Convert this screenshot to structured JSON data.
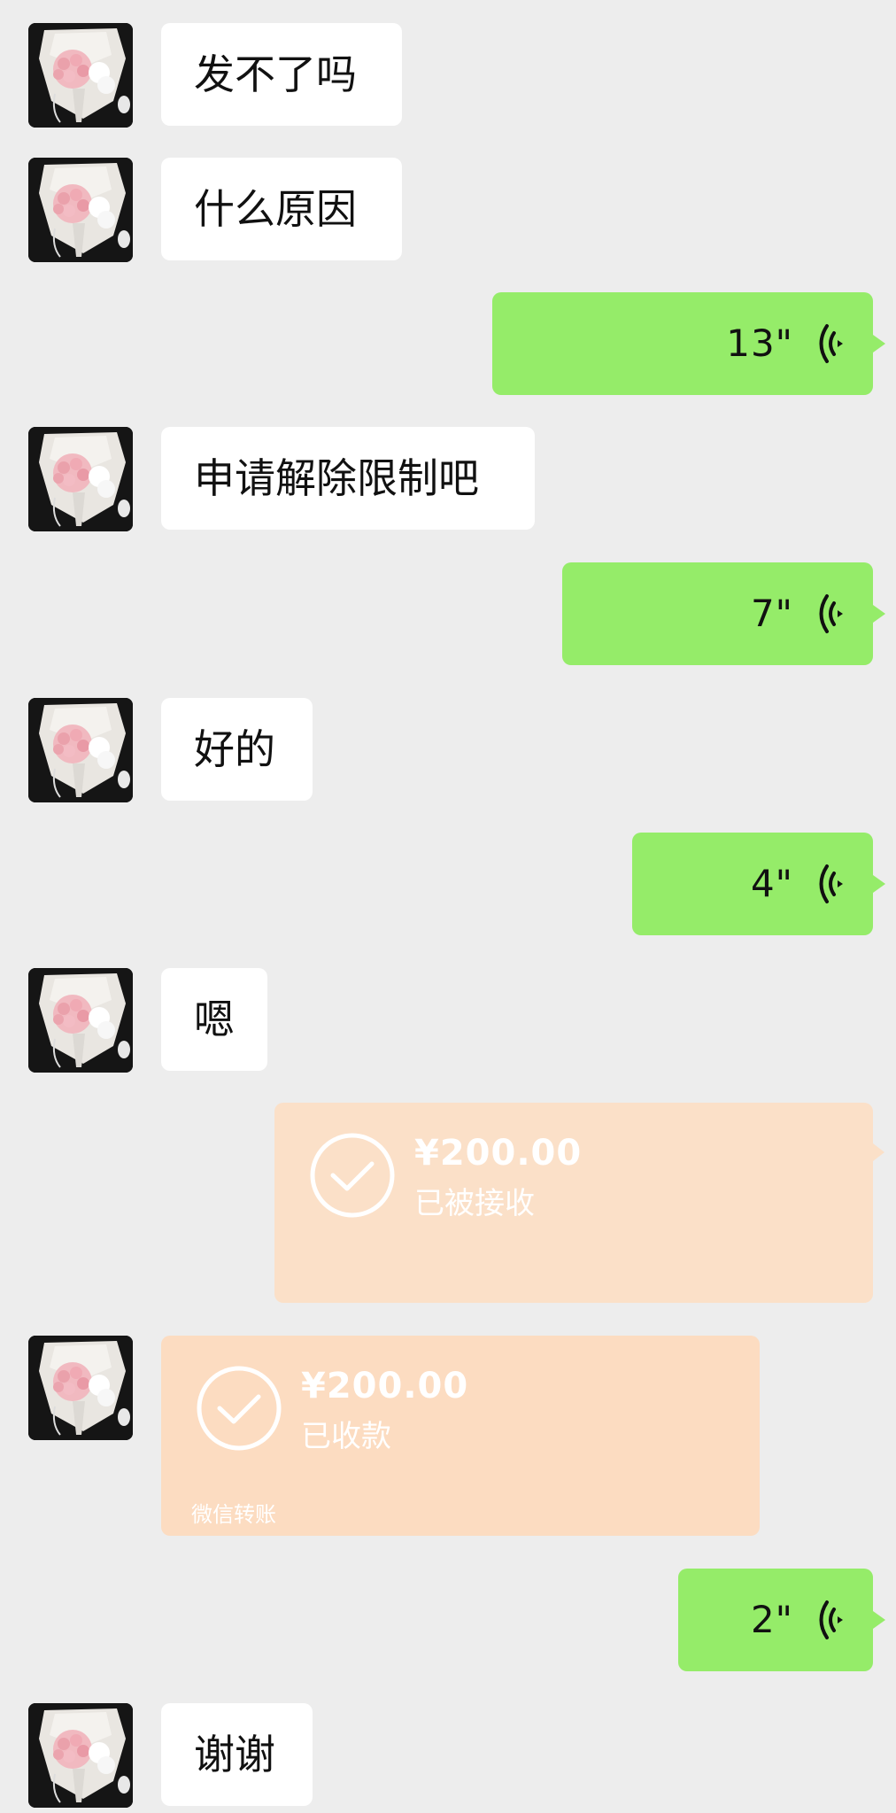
{
  "colors": {
    "background": "#ededed",
    "incoming_bubble": "#ffffff",
    "outgoing_bubble": "#95ec69",
    "transfer_card": "#fbe0c8"
  },
  "contact": {
    "avatar_icon": "flower-bouquet-avatar"
  },
  "messages": [
    {
      "type": "text",
      "side": "in",
      "text": "发不了吗"
    },
    {
      "type": "text",
      "side": "in",
      "text": "什么原因"
    },
    {
      "type": "voice",
      "side": "out",
      "duration": "13\""
    },
    {
      "type": "text",
      "side": "in",
      "text": "申请解除限制吧"
    },
    {
      "type": "voice",
      "side": "out",
      "duration": "7\""
    },
    {
      "type": "text",
      "side": "in",
      "text": "好的"
    },
    {
      "type": "voice",
      "side": "out",
      "duration": "4\""
    },
    {
      "type": "text",
      "side": "in",
      "text": "嗯"
    },
    {
      "type": "transfer",
      "side": "out",
      "amount": "¥200.00",
      "status": "已被接收"
    },
    {
      "type": "transfer",
      "side": "in",
      "amount": "¥200.00",
      "status": "已收款",
      "footer": "微信转账"
    },
    {
      "type": "voice",
      "side": "out",
      "duration": "2\""
    },
    {
      "type": "text",
      "side": "in",
      "text": "谢谢"
    }
  ]
}
